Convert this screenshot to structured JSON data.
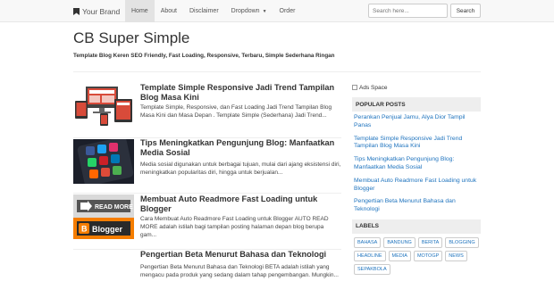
{
  "navbar": {
    "brand": "Your Brand",
    "links": [
      {
        "label": "Home",
        "active": true
      },
      {
        "label": "About",
        "active": false
      },
      {
        "label": "Disclaimer",
        "active": false
      },
      {
        "label": "Dropdown",
        "active": false
      },
      {
        "label": "Order",
        "active": false
      }
    ],
    "search_placeholder": "Search here...",
    "search_button": "Search"
  },
  "header": {
    "title": "CB Super Simple",
    "tagline": "Template Blog Keren SEO Friendly, Fast Loading, Responsive, Terbaru, Simple Sederhana Ringan"
  },
  "posts": [
    {
      "title": "Template Simple Responsive Jadi Trend Tampilan Blog Masa Kini",
      "excerpt": "Template Simple, Responsive, dan Fast Loading Jadi Trend Tampilan Blog Masa Kini dan Masa Depan . Template Simple (Sederhana) Jadi Trend..."
    },
    {
      "title": "Tips Meningkatkan Pengunjung Blog: Manfaatkan Media Sosial",
      "excerpt": "Media sosial digunakan untuk berbagai tujuan, mulai dari ajang eksistensi diri, meningkatkan popularitas diri, hingga untuk berjualan..."
    },
    {
      "title": "Membuat Auto Readmore Fast Loading untuk Blogger",
      "excerpt": "Cara Membuat Auto Readmore Fast Loading untuk Blogger AUTO READ MORE adalah istilah bagi tampilan posting halaman depan blog berupa gam..."
    },
    {
      "title": "Pengertian Beta Menurut Bahasa dan Teknologi",
      "excerpt": "Pengertian Beta Menurut Bahasa dan Teknologi BETA adalah istilah yang mengacu pada produk yang sedang dalam tahap pengembangan. Mungkin..."
    }
  ],
  "thumbs": {
    "readmore_text": "READ MORE",
    "blogger_text": "Blogger"
  },
  "sidebar": {
    "ads_alt": "Ads Space",
    "popular_heading": "POPULAR POSTS",
    "popular": [
      "Perankan Penjual Jamu, Alya Dior Tampil Panas",
      "Template Simple Responsive Jadi Trend Tampilan Blog Masa Kini",
      "Tips Meningkatkan Pengunjung Blog: Manfaatkan Media Sosial",
      "Membuat Auto Readmore Fast Loading untuk Blogger",
      "Pengertian Beta Menurut Bahasa dan Teknologi"
    ],
    "labels_heading": "LABELS",
    "labels": [
      "BAHASA",
      "BANDUNG",
      "BERITA",
      "BLOGGING",
      "HEADLINE",
      "MEDIA",
      "MOTOGP",
      "NEWS",
      "SEPAKBOLA"
    ]
  },
  "colors": {
    "link": "#1e73be",
    "nav_bg": "#f8f8f8",
    "active_tab": "#e3e3e3"
  }
}
